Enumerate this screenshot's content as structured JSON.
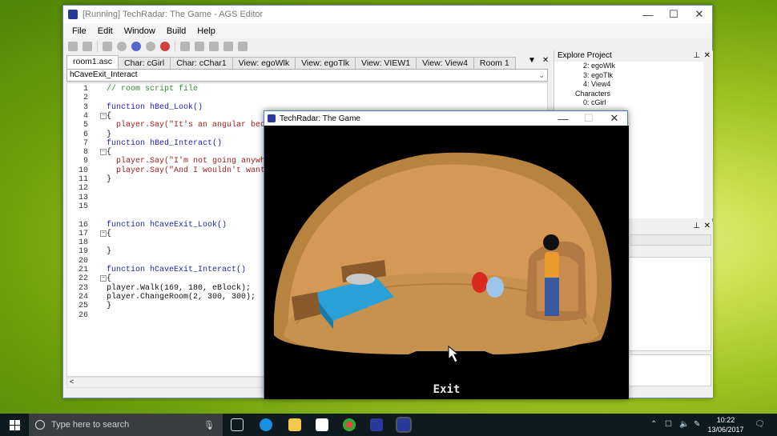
{
  "editor": {
    "title": "[Running] TechRadar: The Game - AGS Editor",
    "menu": [
      "File",
      "Edit",
      "Window",
      "Build",
      "Help"
    ],
    "tabs": [
      "room1.asc",
      "Char: cGirl",
      "Char: cChar1",
      "View: egoWlk",
      "View: egoTlk",
      "View: VIEW1",
      "View: View4",
      "Room 1"
    ],
    "function_selector": "hCaveExit_Interact",
    "code": [
      {
        "n": "1",
        "t": "// room script file"
      },
      {
        "n": "2",
        "t": ""
      },
      {
        "n": "3",
        "t": "function hBed_Look()"
      },
      {
        "n": "4",
        "t": "{"
      },
      {
        "n": "5",
        "t": "  player.Say(\"It's an angular bed"
      },
      {
        "n": "6",
        "t": "}"
      },
      {
        "n": "7",
        "t": "function hBed_Interact()"
      },
      {
        "n": "8",
        "t": "{"
      },
      {
        "n": "9",
        "t": "  player.Say(\"I'm not going anywh"
      },
      {
        "n": "10",
        "t": "  player.Say(\"And I wouldn't want"
      },
      {
        "n": "11",
        "t": "}"
      },
      {
        "n": "12",
        "t": ""
      },
      {
        "n": "13",
        "t": ""
      },
      {
        "n": "15",
        "t": ""
      },
      {
        "n": "16",
        "t": "function hCaveExit_Look()"
      },
      {
        "n": "17",
        "t": "{"
      },
      {
        "n": "18",
        "t": ""
      },
      {
        "n": "19",
        "t": "}"
      },
      {
        "n": "20",
        "t": ""
      },
      {
        "n": "21",
        "t": "function hCaveExit_Interact()"
      },
      {
        "n": "22",
        "t": "{"
      },
      {
        "n": "23",
        "t": "player.Walk(169, 180, eBlock);"
      },
      {
        "n": "24",
        "t": "player.ChangeRoom(2, 300, 300);"
      },
      {
        "n": "25",
        "t": "}"
      },
      {
        "n": "26",
        "t": ""
      }
    ],
    "explore": {
      "title": "Explore Project",
      "items": [
        "2: egoWlk",
        "3: egoTlk",
        "4: View4",
        "Characters",
        "0: cGirl"
      ]
    }
  },
  "game": {
    "title": "TechRadar: The Game",
    "exit_label": "Exit"
  },
  "taskbar": {
    "search_placeholder": "Type here to search",
    "time": "10:22",
    "date": "13/06/2017"
  }
}
